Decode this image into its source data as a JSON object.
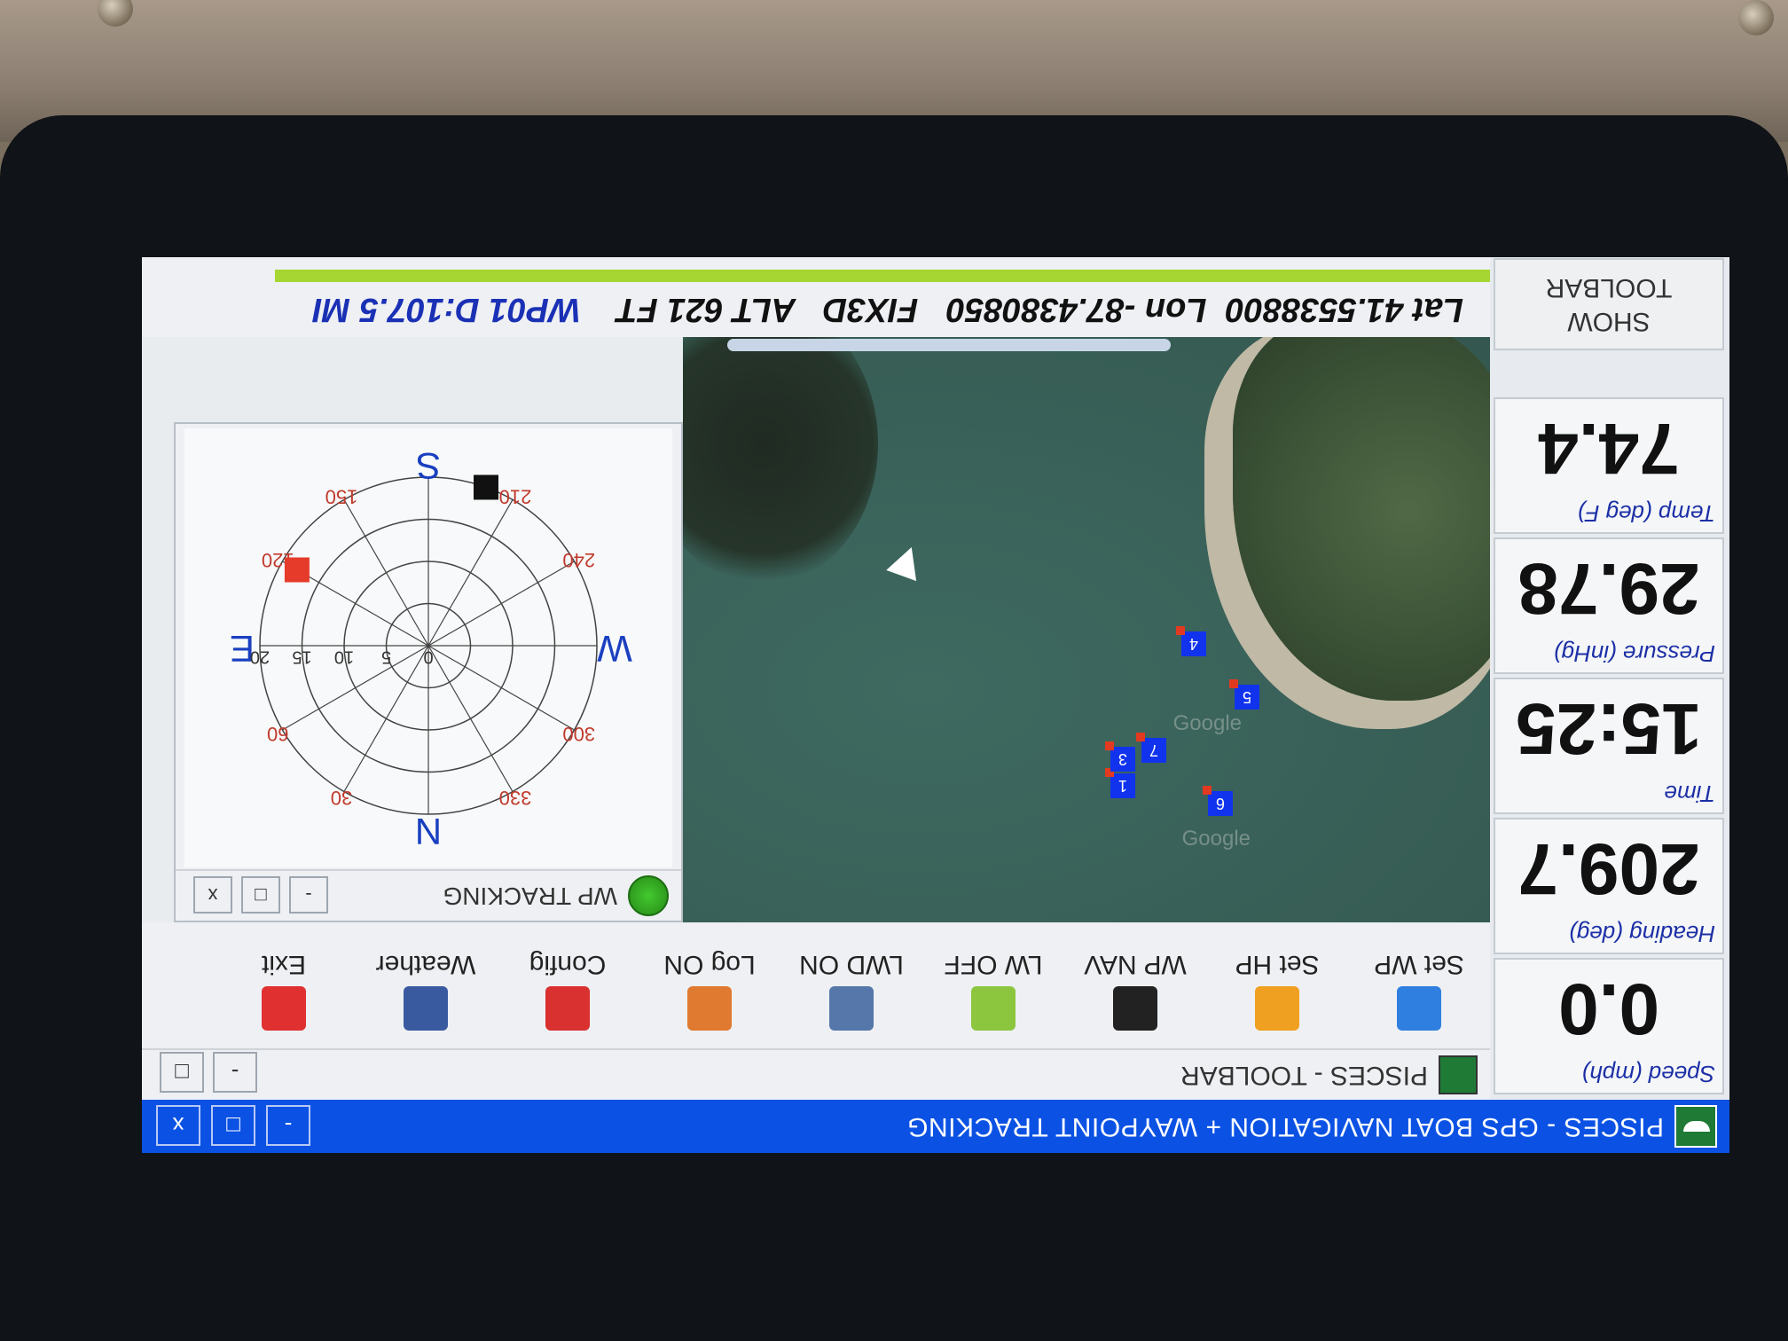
{
  "window": {
    "title": "PISCES - GPS BOAT NAVIGATION + WAYPOINT TRACKING",
    "controls": {
      "minimize": "-",
      "maximize": "□",
      "close": "x"
    }
  },
  "stats": [
    {
      "label": "Speed (mph)",
      "value": "0.0"
    },
    {
      "label": "Heading (deg)",
      "value": "209.7"
    },
    {
      "label": "Time",
      "value": "15:25"
    },
    {
      "label": "Pressure (inHg)",
      "value": "29.78"
    },
    {
      "label": "Temp (deg F)",
      "value": "74.4"
    }
  ],
  "show_toolbar": {
    "line1": "SHOW",
    "line2": "TOOLBAR"
  },
  "toolbar": {
    "title": "PISCES - TOOLBAR",
    "controls": {
      "minimize": "-",
      "maximize": "□"
    },
    "items": [
      {
        "label": "Set WP",
        "icon": "arrow-turn-icon",
        "color": "#2f7fe0"
      },
      {
        "label": "Set HP",
        "icon": "warning-icon",
        "color": "#f0a020"
      },
      {
        "label": "WP NAV",
        "icon": "runner-icon",
        "color": "#222222"
      },
      {
        "label": "LW OFF",
        "icon": "arrows-icon",
        "color": "#8cc63f"
      },
      {
        "label": "LWD ON",
        "icon": "arrow-dots-icon",
        "color": "#5577aa"
      },
      {
        "label": "Log ON",
        "icon": "pencil-icon",
        "color": "#e07a30"
      },
      {
        "label": "Config",
        "icon": "tools-icon",
        "color": "#d93030"
      },
      {
        "label": "Weather",
        "icon": "cloud-icon",
        "color": "#3a5aa0"
      },
      {
        "label": "Exit",
        "icon": "exit-icon",
        "color": "#e03030"
      }
    ]
  },
  "gps": {
    "lat_text": "Lat 41.5538800",
    "lon_text": "Lon -87.4380850",
    "fix": "FIX3D",
    "alt": "ALT 621 FT",
    "wp": "WP01 D:107.5 MI"
  },
  "map": {
    "waypoints": [
      "1",
      "3",
      "4",
      "5",
      "6",
      "7"
    ],
    "watermark": "Google"
  },
  "wp_tracking": {
    "title": "WP TRACKING",
    "controls": {
      "minimize": "-",
      "maximize": "□",
      "close": "x"
    },
    "compass": {
      "N": "N",
      "E": "E",
      "S": "S",
      "W": "W"
    },
    "angle_labels": [
      "30",
      "60",
      "120",
      "150",
      "210",
      "240",
      "300",
      "330"
    ],
    "ring_labels": [
      "0",
      "5",
      "10",
      "15",
      "20"
    ],
    "targets": [
      {
        "angle": 120,
        "radius": 18,
        "color": "#e63b2a"
      },
      {
        "angle": 200,
        "radius": 20,
        "color": "#111111"
      }
    ]
  }
}
